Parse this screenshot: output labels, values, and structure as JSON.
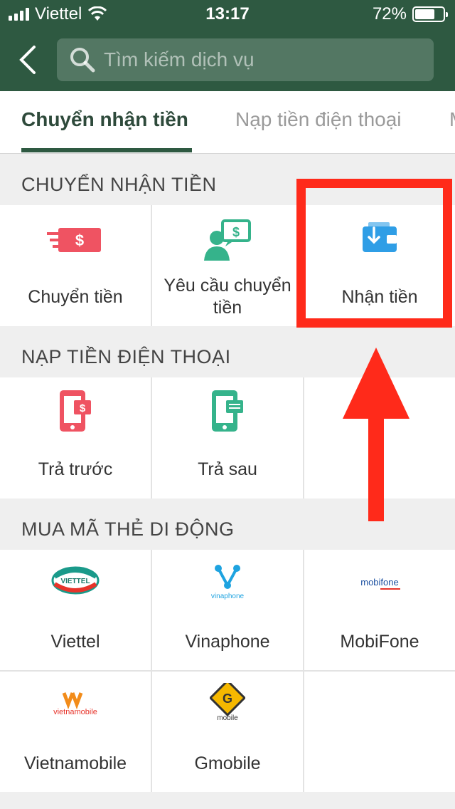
{
  "status_bar": {
    "carrier": "Viettel",
    "time": "13:17",
    "battery": "72%",
    "battery_level": 0.72
  },
  "search": {
    "placeholder": "Tìm kiếm dịch vụ"
  },
  "tabs": [
    {
      "label": "Chuyển nhận tiền",
      "active": true
    },
    {
      "label": "Nạp tiền điện thoại",
      "active": false
    },
    {
      "label": "M",
      "active": false
    }
  ],
  "sections": [
    {
      "title": "CHUYỂN NHẬN TIỀN",
      "items": [
        {
          "label": "Chuyển tiền",
          "icon": "money-send-icon"
        },
        {
          "label_line1": "Yêu cầu chuyển",
          "label_line2": "tiền",
          "icon": "request-money-icon"
        },
        {
          "label": "Nhận tiền",
          "icon": "wallet-receive-icon"
        }
      ]
    },
    {
      "title": "NẠP TIỀN ĐIỆN THOẠI",
      "items": [
        {
          "label": "Trả trước",
          "icon": "prepaid-phone-icon"
        },
        {
          "label": "Trả sau",
          "icon": "postpaid-phone-icon"
        }
      ]
    },
    {
      "title": "MUA MÃ THẺ DI ĐỘNG",
      "items": [
        {
          "label": "Viettel",
          "icon": "viettel-logo"
        },
        {
          "label": "Vinaphone",
          "icon": "vinaphone-logo"
        },
        {
          "label": "MobiFone",
          "icon": "mobifone-logo"
        },
        {
          "label": "Vietnamobile",
          "icon": "vietnamobile-logo"
        },
        {
          "label": "Gmobile",
          "icon": "gmobile-logo"
        }
      ]
    }
  ],
  "logos": {
    "viettel": "VIETTEL",
    "vinaphone": "vinaphone",
    "mobifone": "mobifone",
    "vietnamobile": "vietnamobile",
    "gmobile": "mobile"
  },
  "colors": {
    "header": "#2e5941",
    "accent_red": "#ef5362",
    "accent_green": "#35b38b",
    "accent_blue": "#2f9ee6",
    "annotation": "#ff2a1a"
  }
}
